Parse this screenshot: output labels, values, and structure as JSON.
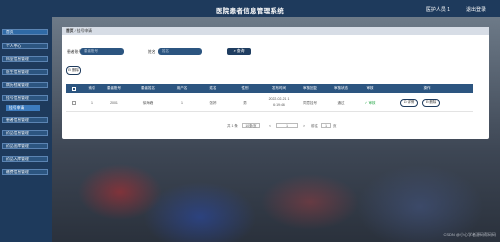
{
  "header": {
    "title": "医院患者信息管理系统",
    "user": "医护人员 1",
    "logout": "退出登录"
  },
  "sidebar": {
    "items": [
      "首页",
      "个人中心",
      "科室信息管理",
      "医生信息管理",
      "病历档案管理",
      "挂号信息管理",
      "患者信息管理",
      "药品信息管理",
      "药品出库管理",
      "药品入库管理",
      "缴费信息管理"
    ],
    "sub_item": "挂号申请"
  },
  "breadcrumb": {
    "home": "首页",
    "sep": "/",
    "current": "挂号申请"
  },
  "search": {
    "label1": "患者账号",
    "placeholder1": "患者账号",
    "label2": "姓名",
    "placeholder2": "姓名",
    "button": "查询"
  },
  "toolbar": {
    "delete": "删除"
  },
  "table": {
    "headers": [
      "",
      "索引",
      "患者账号",
      "患者姓名",
      "用户名",
      "姓名",
      "性别",
      "发布时间",
      "审核回复",
      "审核状态",
      "审核",
      "操作"
    ],
    "rows": [
      {
        "index": "1",
        "account": "2001",
        "patient_name": "徐海峰",
        "username": "1",
        "name": "张婷",
        "gender": "男",
        "time_date": "2022-02-21 1",
        "time_clock": "6:19:46",
        "reply": "同意挂号",
        "status": "通过",
        "review": "审核"
      }
    ],
    "actions": {
      "detail": "详情",
      "delete": "删除"
    }
  },
  "pagination": {
    "total": "共 1 条",
    "size": "10条/页",
    "prev": "<",
    "page": "1",
    "next": ">",
    "goto": "前往",
    "goto_value": "1",
    "goto_suffix": "页"
  },
  "watermark": "CSDN @小心学者源码帮码码",
  "colors": {
    "header": "#1e3a5c",
    "button": "#2c5580",
    "status_ok": "#2aa84a"
  }
}
